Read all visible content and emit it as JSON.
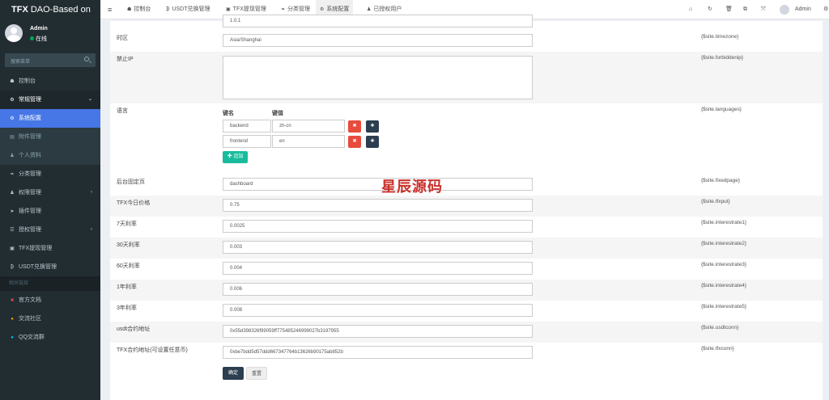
{
  "app": {
    "title_bold": "TFX",
    "title_rest": " DAO-Based on"
  },
  "user": {
    "name": "Admin",
    "status": "在线"
  },
  "search": {
    "placeholder": "搜索菜单"
  },
  "sidebar": {
    "items": [
      {
        "label": "控制台",
        "icon": "dashboard-icon",
        "glyph": "☗"
      },
      {
        "label": "常规管理",
        "icon": "cogs-icon",
        "glyph": "⚙",
        "caret": "⌄"
      },
      {
        "label": "系统配置",
        "icon": "gear-icon",
        "glyph": "⚙"
      },
      {
        "label": "附件管理",
        "icon": "file-icon",
        "glyph": "▤"
      },
      {
        "label": "个人资料",
        "icon": "user-icon",
        "glyph": "♟"
      },
      {
        "label": "分类管理",
        "icon": "leaf-icon",
        "glyph": "❧"
      },
      {
        "label": "权限管理",
        "icon": "group-icon",
        "glyph": "♟",
        "caret": "‹"
      },
      {
        "label": "插件管理",
        "icon": "rocket-icon",
        "glyph": "➤"
      },
      {
        "label": "授权管理",
        "icon": "list-icon",
        "glyph": "☰",
        "caret": "‹"
      },
      {
        "label": "TFX提现管理",
        "icon": "money-icon",
        "glyph": "▣"
      },
      {
        "label": "USDT兑换管理",
        "icon": "bitcoin-icon",
        "glyph": "₿"
      }
    ],
    "section_header": "相关链接",
    "links": [
      {
        "label": "官方文档",
        "icon": "book-icon",
        "glyph": "■",
        "color": "#dd4b39"
      },
      {
        "label": "交流社区",
        "icon": "comments-icon",
        "glyph": "●",
        "color": "#f39c12"
      },
      {
        "label": "QQ交流群",
        "icon": "qq-icon",
        "glyph": "●",
        "color": "#00c0ef"
      }
    ]
  },
  "topnav": {
    "menu_icon": "≡",
    "tabs": [
      {
        "label": "控制台",
        "glyph": "☗"
      },
      {
        "label": "USDT兑换管理",
        "glyph": "₿"
      },
      {
        "label": "TFX提现管理",
        "glyph": "▣"
      },
      {
        "label": "分类管理",
        "glyph": "❧"
      },
      {
        "label": "系统配置",
        "glyph": "⚙"
      },
      {
        "label": "已授权用户",
        "glyph": "♟"
      }
    ],
    "right_icons": [
      "⌂",
      "↻",
      "🗑",
      "⧉",
      "⤧"
    ],
    "user": "Admin",
    "more": "⚙"
  },
  "form": {
    "top_value": "1.0.1",
    "timezone": {
      "label": "时区",
      "value": "Asia/Shanghai",
      "tag": "{$site.timezone}"
    },
    "forbiddenip": {
      "label": "禁止IP",
      "value": "",
      "tag": "{$site.forbiddenip}"
    },
    "languages": {
      "label": "语言",
      "col_key": "键名",
      "col_value": "键值",
      "rows": [
        {
          "key": "backend",
          "value": "zh-cn"
        },
        {
          "key": "frontend",
          "value": "en"
        }
      ],
      "add": "✚ 追加",
      "tag": "{$site.languages}"
    },
    "fields": [
      {
        "label": "后台固定页",
        "value": "dashboard",
        "tag": "{$site.fixedpage}"
      },
      {
        "label": "TFX今日价格",
        "value": "0.75",
        "tag": "{$site.tfxput}"
      },
      {
        "label": "7天利率",
        "value": "0.0025",
        "tag": "{$site.interestrate1}"
      },
      {
        "label": "30天利率",
        "value": "0.003",
        "tag": "{$site.interestrate2}"
      },
      {
        "label": "60天利率",
        "value": "0.004",
        "tag": "{$site.interestrate3}"
      },
      {
        "label": "1年利率",
        "value": "0.006",
        "tag": "{$site.interestrate4}"
      },
      {
        "label": "3年利率",
        "value": "0.008",
        "tag": "{$site.interestrate5}"
      },
      {
        "label": "usdt合约地址",
        "value": "0x55d398326f99059ff775485246999027b3197955",
        "tag": "{$site.usdtconn}"
      },
      {
        "label": "TFX合约地址(可设置任意币)",
        "value": "0xbe7bdd5d57ddd667347764b13626b90175ab852b",
        "tag": "{$site.tfxconn}"
      }
    ],
    "submit": "确定",
    "reset": "重置"
  },
  "watermark": "星辰源码",
  "colors": {
    "sidebar": "#222d32",
    "active": "#4776e6",
    "danger": "#e74c3c",
    "dark_btn": "#2c3e50",
    "success": "#18bc9c"
  }
}
